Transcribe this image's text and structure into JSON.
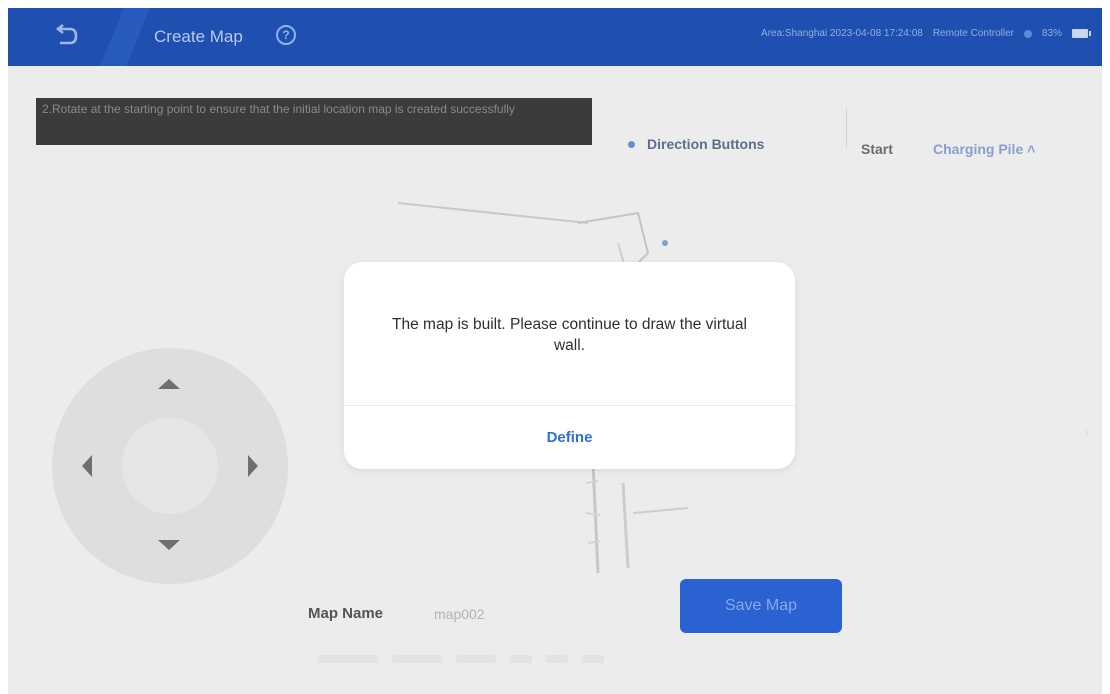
{
  "header": {
    "title": "Create Map",
    "status_text": "Area:Shanghai  2023-04-08 17:24:08",
    "controller_label": "Remote Controller",
    "battery_label": "83%"
  },
  "toolbar": {
    "tip_text": "2.Rotate at the starting point to ensure that the initial location map is created successfully",
    "direction_label": "Direction Buttons",
    "start_label": "Start",
    "charging_label": "Charging Pile"
  },
  "form": {
    "map_name_label": "Map Name",
    "map_name_value": "map002",
    "save_label": "Save Map"
  },
  "dialog": {
    "message": "The map is built. Please continue to draw the virtual wall.",
    "button_label": "Define"
  },
  "colors": {
    "header_bg": "#1f4fb0",
    "accent": "#2f6fd4",
    "save_button": "#2a62d1"
  }
}
